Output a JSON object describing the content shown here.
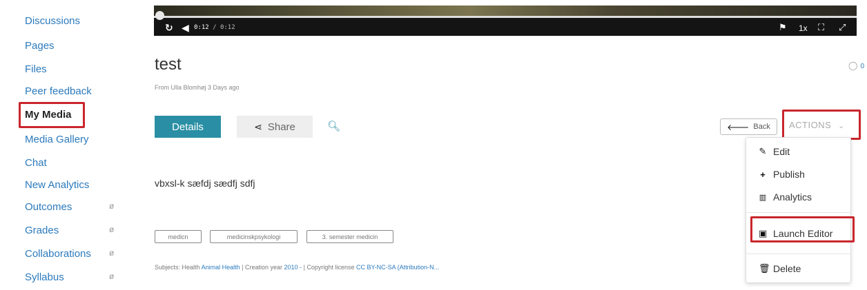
{
  "sidebar": {
    "items": [
      {
        "label": "Discussions"
      },
      {
        "label": "Pages"
      },
      {
        "label": "Files"
      },
      {
        "label": "Peer feedback"
      },
      {
        "label": "My Media"
      },
      {
        "label": "Media Gallery"
      },
      {
        "label": "Chat"
      },
      {
        "label": "New Analytics"
      },
      {
        "label": "Outcomes"
      },
      {
        "label": "Grades"
      },
      {
        "label": "Collaborations"
      },
      {
        "label": "Syllabus"
      }
    ],
    "hidden_icon": "eye-slash-icon"
  },
  "player": {
    "current_time": "0:12",
    "duration": "/ 0:12",
    "speed": "1x",
    "progress": 0.0
  },
  "media": {
    "title": "test",
    "byline": "From Ulla Blomhøj 3 Days ago",
    "comment_count": "0",
    "description": "vbxsl-k sæfdj sædfj sdfj",
    "tags": [
      "medicn",
      "medicinskpsykologi",
      "3. semester medicin"
    ]
  },
  "tabs": {
    "details": "Details",
    "share": "Share"
  },
  "toolbar": {
    "back": "Back",
    "actions": "ACTIONS"
  },
  "actions_menu": {
    "edit": "Edit",
    "publish": "Publish",
    "analytics": "Analytics",
    "launch_editor": "Launch Editor",
    "delete": "Delete"
  },
  "meta": {
    "subjects_label": "Subjects: Health",
    "subject_link": "Animal Health",
    "sep1": "|",
    "creation_label": "Creation year",
    "creation_value": "2010 -",
    "sep2": "|",
    "license_label": "Copyright license",
    "license_value": "CC BY-NC-SA (Attribution-N..."
  },
  "colors": {
    "accent": "#2a8fa4",
    "link": "#2b7abc",
    "highlight": "#c9262c"
  }
}
